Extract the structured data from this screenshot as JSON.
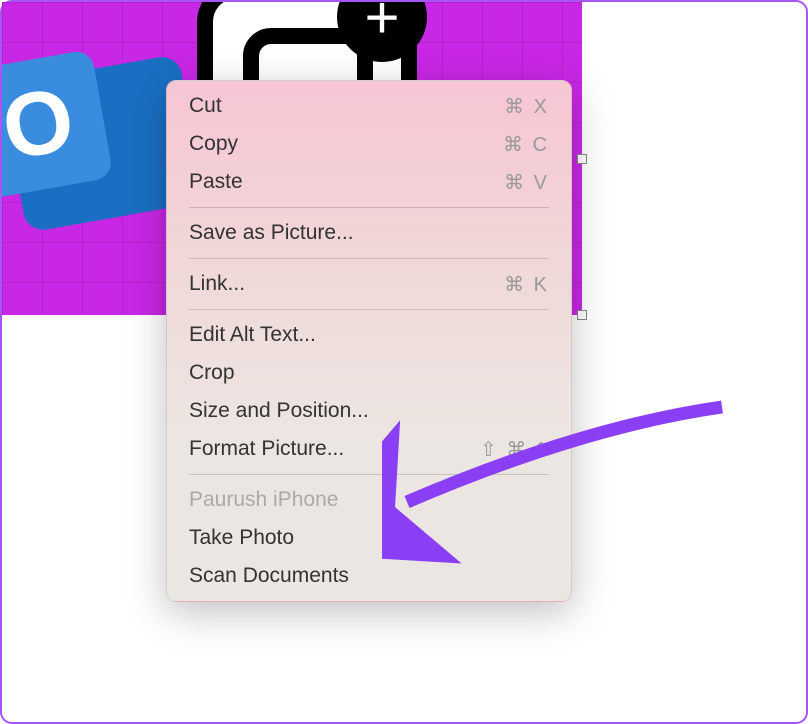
{
  "background_image": {
    "description": "Outlook email icon with media overlay and plus badge on purple grid",
    "outlook_letter": "O",
    "plus_symbol": "+"
  },
  "context_menu": {
    "groups": [
      [
        {
          "label": "Cut",
          "shortcut": "⌘ X",
          "enabled": true
        },
        {
          "label": "Copy",
          "shortcut": "⌘ C",
          "enabled": true
        },
        {
          "label": "Paste",
          "shortcut": "⌘ V",
          "enabled": true
        }
      ],
      [
        {
          "label": "Save as Picture...",
          "shortcut": "",
          "enabled": true
        }
      ],
      [
        {
          "label": "Link...",
          "shortcut": "⌘ K",
          "enabled": true
        }
      ],
      [
        {
          "label": "Edit Alt Text...",
          "shortcut": "",
          "enabled": true
        },
        {
          "label": "Crop",
          "shortcut": "",
          "enabled": true
        },
        {
          "label": "Size and Position...",
          "shortcut": "",
          "enabled": true
        },
        {
          "label": "Format Picture...",
          "shortcut": "⇧ ⌘ 1",
          "enabled": true
        }
      ],
      [
        {
          "label": "Paurush iPhone",
          "shortcut": "",
          "enabled": false
        },
        {
          "label": "Take Photo",
          "shortcut": "",
          "enabled": true
        },
        {
          "label": "Scan Documents",
          "shortcut": "",
          "enabled": true
        }
      ]
    ]
  },
  "annotation": {
    "arrow_target": "Format Picture...",
    "arrow_color": "#8b3ff5"
  }
}
